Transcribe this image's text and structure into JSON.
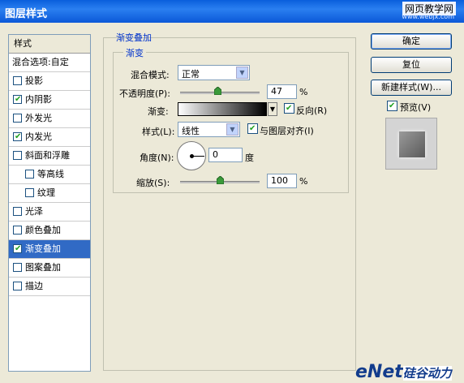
{
  "window": {
    "title": "图层样式",
    "watermark": "网页教学网",
    "watermark_url": "www.webjx.com"
  },
  "sidebar": {
    "header": "样式",
    "blend_label": "混合选项:自定",
    "items": [
      {
        "label": "投影",
        "checked": false
      },
      {
        "label": "内阴影",
        "checked": true
      },
      {
        "label": "外发光",
        "checked": false
      },
      {
        "label": "内发光",
        "checked": true
      },
      {
        "label": "斜面和浮雕",
        "checked": false
      },
      {
        "label": "等高线",
        "checked": false,
        "sub": true
      },
      {
        "label": "纹理",
        "checked": false,
        "sub": true
      },
      {
        "label": "光泽",
        "checked": false
      },
      {
        "label": "颜色叠加",
        "checked": false
      },
      {
        "label": "渐变叠加",
        "checked": true,
        "selected": true
      },
      {
        "label": "图案叠加",
        "checked": false
      },
      {
        "label": "描边",
        "checked": false
      }
    ]
  },
  "panel": {
    "title": "渐变叠加",
    "subtitle": "渐变",
    "blend_mode_label": "混合模式:",
    "blend_mode_value": "正常",
    "opacity_label": "不透明度(P):",
    "opacity_value": "47",
    "opacity_unit": "%",
    "opacity_level": 0.47,
    "gradient_label": "渐变:",
    "reverse_label": "反向(R)",
    "reverse_checked": true,
    "style_label": "样式(L):",
    "style_value": "线性",
    "align_label": "与图层对齐(I)",
    "align_checked": true,
    "angle_label": "角度(N):",
    "angle_value": "0",
    "angle_unit": "度",
    "scale_label": "缩放(S):",
    "scale_value": "100",
    "scale_unit": "%",
    "scale_level": 0.5
  },
  "buttons": {
    "ok": "确定",
    "reset": "复位",
    "new_style": "新建样式(W)...",
    "preview_label": "预览(V)",
    "preview_checked": true
  },
  "logo": {
    "text": "eNet",
    "cn": "硅谷动力"
  }
}
